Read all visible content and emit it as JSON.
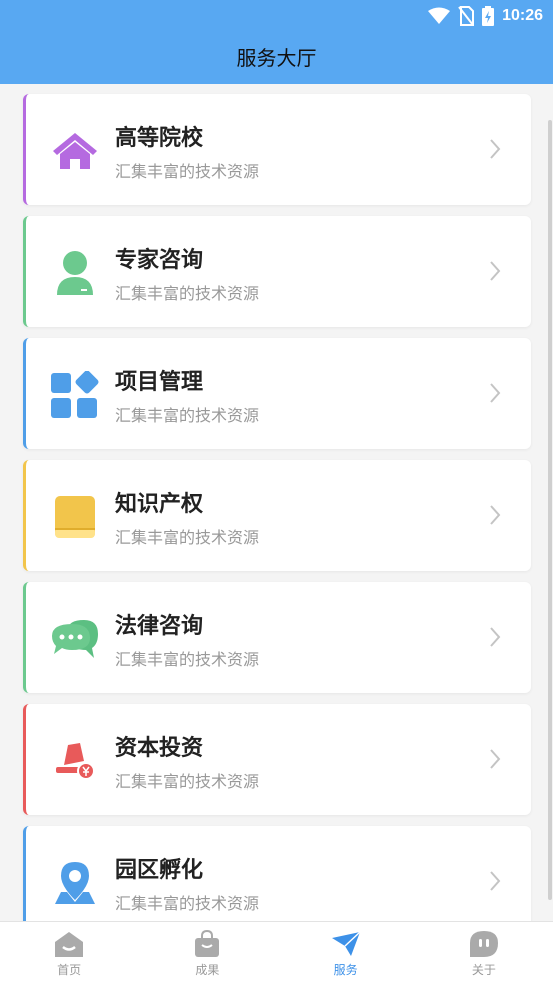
{
  "status_bar": {
    "time": "10:26"
  },
  "header": {
    "title": "服务大厅"
  },
  "services": [
    {
      "id": "university",
      "title": "高等院校",
      "subtitle": "汇集丰富的技术资源",
      "icon": "house-icon",
      "accent": "#b56ae0"
    },
    {
      "id": "expert",
      "title": "专家咨询",
      "subtitle": "汇集丰富的技术资源",
      "icon": "person-icon",
      "accent": "#6cc98e"
    },
    {
      "id": "project",
      "title": "项目管理",
      "subtitle": "汇集丰富的技术资源",
      "icon": "grid-icon",
      "accent": "#4f9ee8"
    },
    {
      "id": "ip",
      "title": "知识产权",
      "subtitle": "汇集丰富的技术资源",
      "icon": "book-icon",
      "accent": "#f2c54b"
    },
    {
      "id": "legal",
      "title": "法律咨询",
      "subtitle": "汇集丰富的技术资源",
      "icon": "chat-icon",
      "accent": "#6cc98e"
    },
    {
      "id": "capital",
      "title": "资本投资",
      "subtitle": "汇集丰富的技术资源",
      "icon": "invest-icon",
      "accent": "#e85a5a"
    },
    {
      "id": "park",
      "title": "园区孵化",
      "subtitle": "汇集丰富的技术资源",
      "icon": "location-icon",
      "accent": "#4f9ee8"
    }
  ],
  "tabbar": {
    "tabs": [
      {
        "label": "首页",
        "icon": "home-icon"
      },
      {
        "label": "成果",
        "icon": "bag-icon"
      },
      {
        "label": "服务",
        "icon": "send-icon",
        "active": true
      },
      {
        "label": "关于",
        "icon": "face-icon"
      }
    ]
  },
  "colors": {
    "header": "#58a8f2",
    "tab_active": "#3d91e8",
    "tab_inactive": "#aaaaaa"
  }
}
